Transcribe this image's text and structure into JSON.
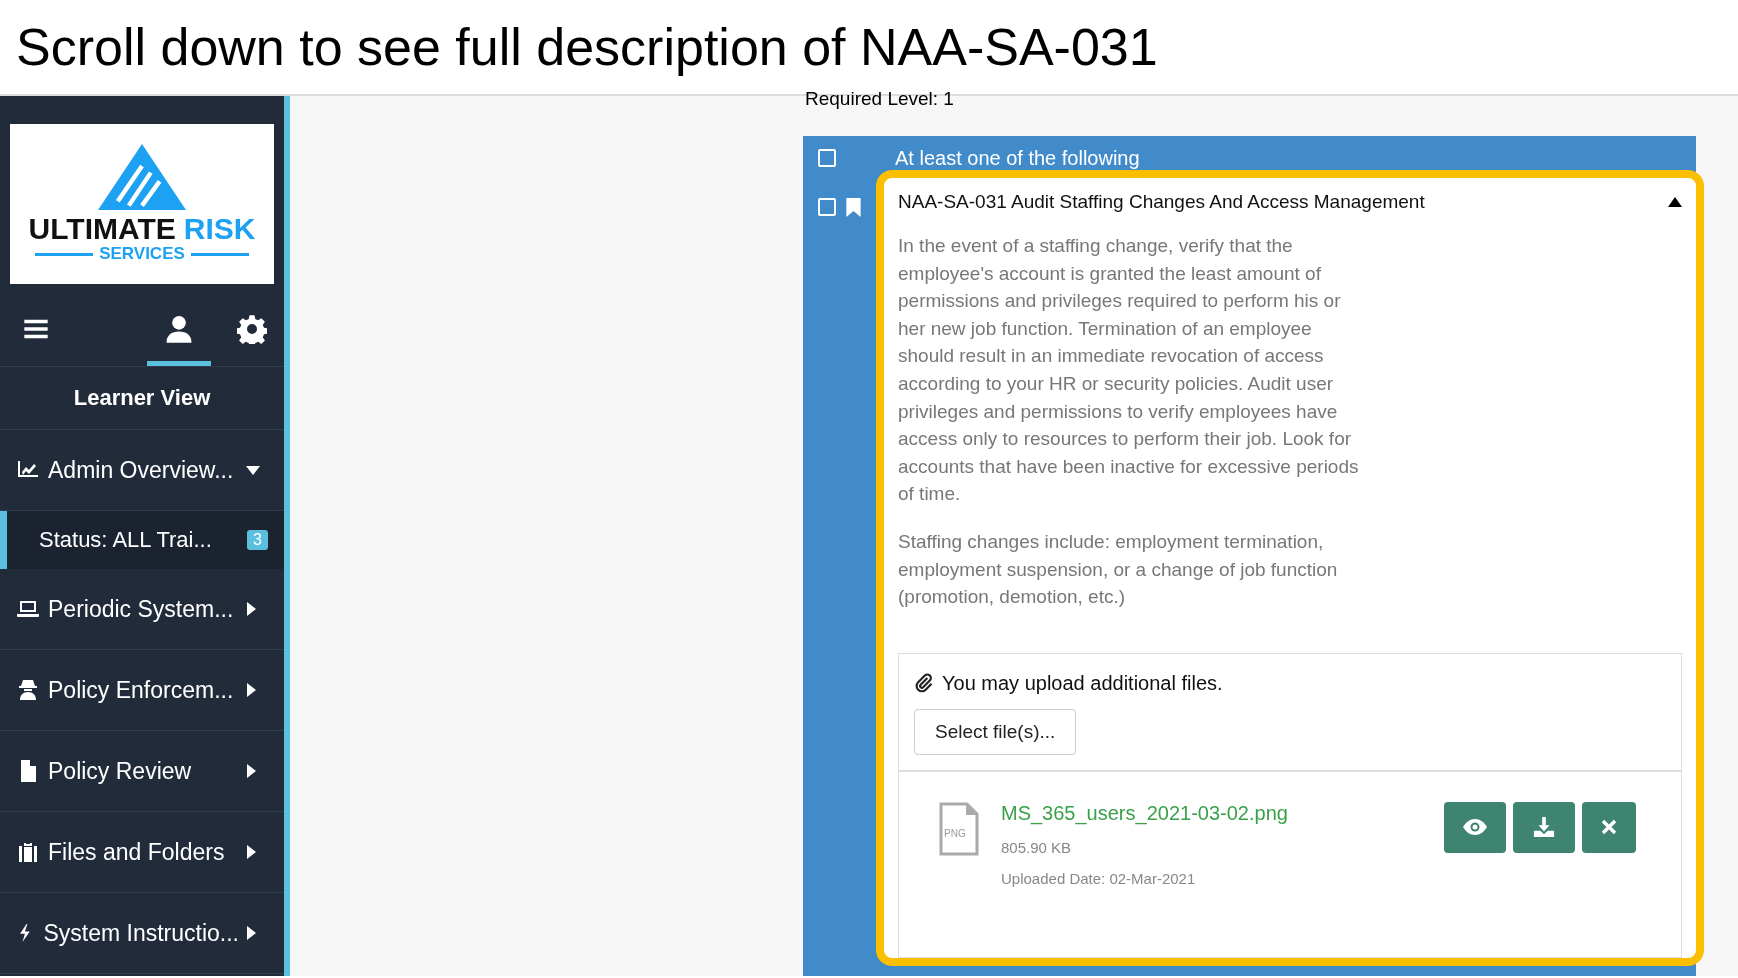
{
  "heading": {
    "text": "Scroll down to see full description of ",
    "code": "NAA-SA-031"
  },
  "sidebar": {
    "logo": {
      "word1": "ULTIMATE",
      "word2": "RISK",
      "word3": "SERVICES"
    },
    "tabs": [
      {
        "kind": "menu",
        "selected": false
      },
      {
        "kind": "user",
        "selected": true
      },
      {
        "kind": "settings",
        "selected": false
      }
    ],
    "view_title": "Learner View",
    "items": [
      {
        "label": "Admin Overview...",
        "kind": "chart",
        "expanded": true,
        "children": [
          {
            "label": "Status: ALL Trai...",
            "badge": "3",
            "selected": true
          }
        ]
      },
      {
        "label": "Periodic System...",
        "kind": "laptop",
        "expanded": false
      },
      {
        "label": "Policy Enforcem...",
        "kind": "spy",
        "expanded": false
      },
      {
        "label": "Policy Review",
        "kind": "file",
        "expanded": false
      },
      {
        "label": "Files and Folders",
        "kind": "briefcase",
        "expanded": false
      },
      {
        "label": "System Instructio...",
        "kind": "bolt",
        "expanded": false
      }
    ]
  },
  "required_level": "Required Level: 1",
  "group": {
    "label": "At least one of the following",
    "checked": false
  },
  "requirement": {
    "checked": false,
    "bookmarked": true,
    "title": "NAA-SA-031 Audit Staffing Changes And Access Management",
    "expanded": true,
    "highlighted": true,
    "description": [
      "In the event of a staffing change, verify that the employee's account is granted the least amount of permissions and privileges required to perform his or her new job function. Termination of an employee should result in an immediate revocation of access according to your HR or security policies. Audit user privileges and permissions to verify employees have access only to resources to perform their job. Look for accounts that have been inactive for excessive periods of time.",
      "Staffing changes include: employment termination, employment suspension, or a change of job function (promotion, demotion, etc.)"
    ],
    "upload": {
      "prompt": "You may upload additional files.",
      "button": "Select file(s)..."
    },
    "files": [
      {
        "type": "PNG",
        "name": "MS_365_users_2021-03-02.png",
        "size": "805.90 KB",
        "date": "Uploaded Date: 02-Mar-2021"
      }
    ]
  }
}
